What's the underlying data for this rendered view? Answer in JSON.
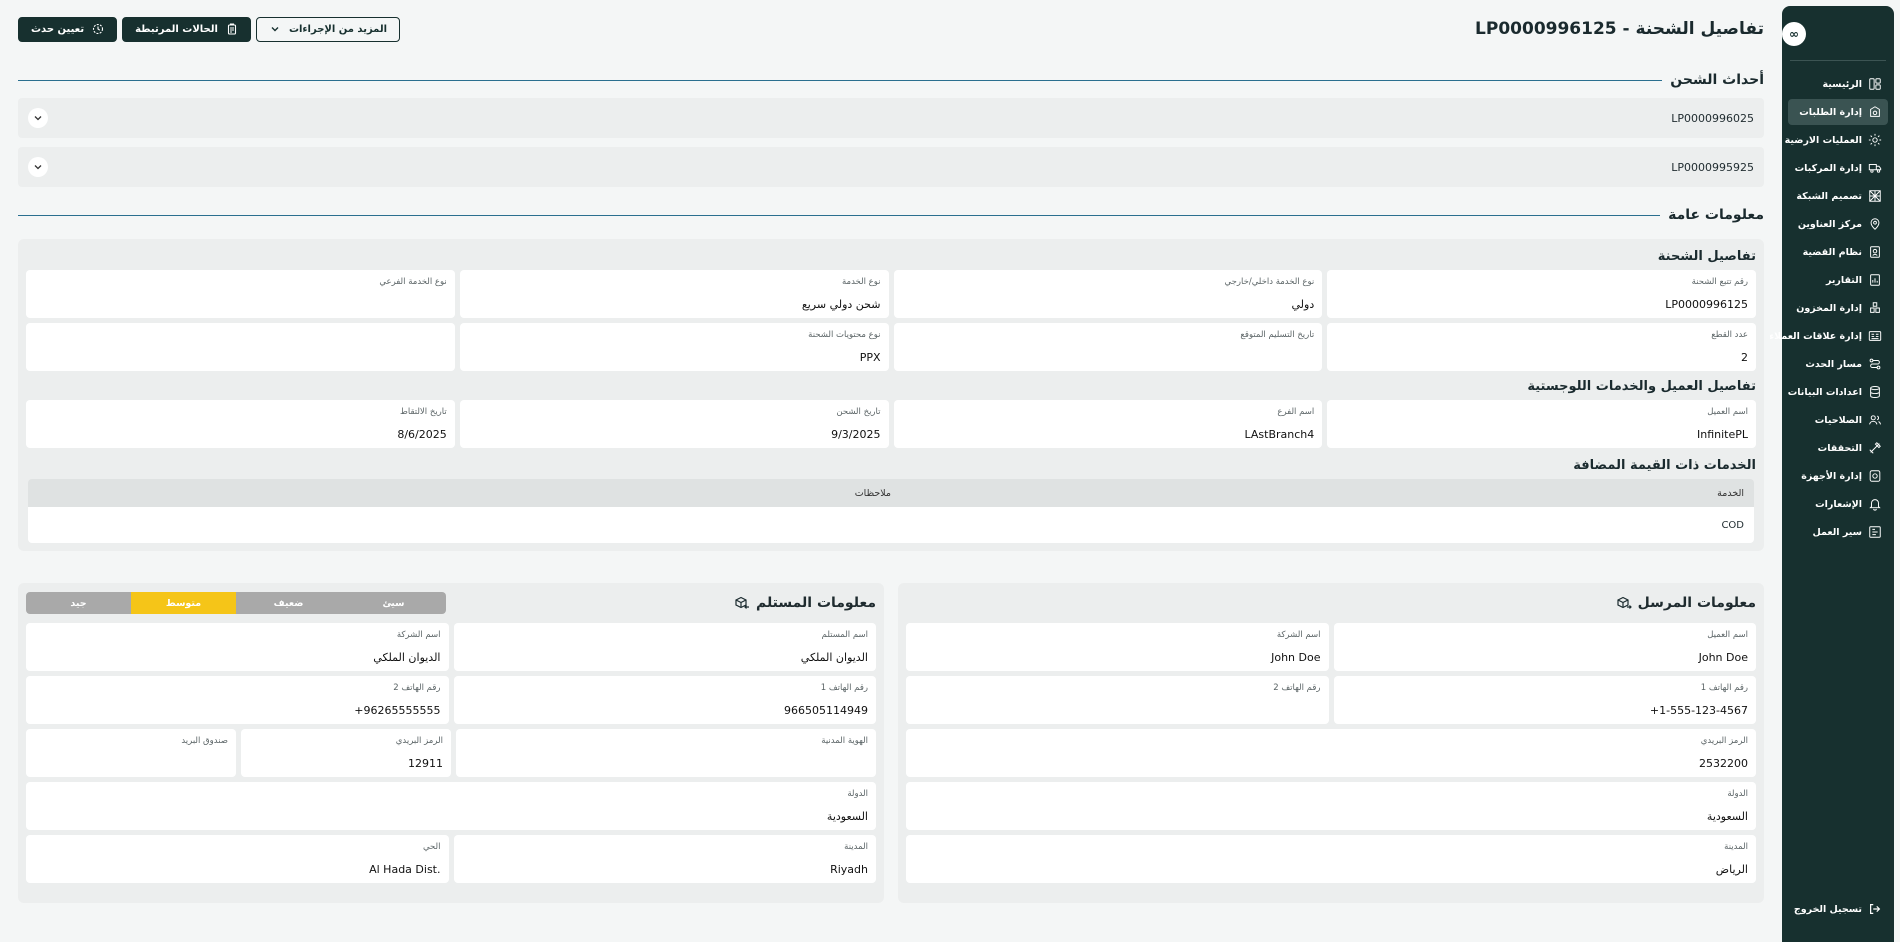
{
  "page": {
    "title": "تفاصيل الشحنة - LP0000996125"
  },
  "actions": {
    "assign_event": "تعيين حدث",
    "linked_cases": "الحالات المرتبطة",
    "more_actions": "المزيد من الإجراءات"
  },
  "sidebar": {
    "logo": "∞",
    "items": [
      {
        "label": "الرئيسية",
        "icon": "dashboard-icon"
      },
      {
        "label": "إدارة الطلبات",
        "icon": "orders-icon"
      },
      {
        "label": "العمليات الارضية",
        "icon": "ground-ops-icon"
      },
      {
        "label": "إدارة المركبات",
        "icon": "truck-icon"
      },
      {
        "label": "تصميم الشبكة",
        "icon": "network-icon"
      },
      {
        "label": "مركز العناوين",
        "icon": "location-icon"
      },
      {
        "label": "نظام القضية",
        "icon": "case-icon"
      },
      {
        "label": "التقارير",
        "icon": "report-icon"
      },
      {
        "label": "إدارة المخزون",
        "icon": "inventory-icon"
      },
      {
        "label": "إدارة علاقات العملاء",
        "icon": "crm-icon"
      },
      {
        "label": "مسار الحدث",
        "icon": "route-icon"
      },
      {
        "label": "اعدادات البيانات",
        "icon": "database-icon"
      },
      {
        "label": "الصلاحيات",
        "icon": "users-icon"
      },
      {
        "label": "التحققات",
        "icon": "tools-icon"
      },
      {
        "label": "إدارة الأجهزة",
        "icon": "devices-icon"
      },
      {
        "label": "الإشعارات",
        "icon": "bell-icon"
      },
      {
        "label": "سير العمل",
        "icon": "workflow-icon"
      }
    ],
    "active_index": 1,
    "logout": "تسجيل الخروج"
  },
  "events": {
    "title": "أحداث الشحن",
    "items": [
      "LP0000996025",
      "LP0000995925"
    ]
  },
  "general": {
    "title": "معلومات عامة",
    "shipment_details": {
      "title": "تفاصيل الشحنة",
      "row1": [
        {
          "label": "رقم تتبع الشحنة",
          "value": "LP0000996125"
        },
        {
          "label": "نوع الخدمة داخلي/خارجي",
          "value": "دولي"
        },
        {
          "label": "نوع الخدمة",
          "value": "شحن دولي سريع"
        },
        {
          "label": "نوع الخدمة الفرعي",
          "value": ""
        }
      ],
      "row2": [
        {
          "label": "عدد القطع",
          "value": "2"
        },
        {
          "label": "تاريخ التسليم المتوقع",
          "value": ""
        },
        {
          "label": "نوع محتويات الشحنة",
          "value": "PPX"
        },
        {
          "label": "",
          "value": ""
        }
      ]
    },
    "customer_details": {
      "title": "تفاصيل العميل والخدمات اللوجستية",
      "row1": [
        {
          "label": "اسم العميل",
          "value": "InfinitePL"
        },
        {
          "label": "اسم الفرع",
          "value": "LAstBranch4"
        },
        {
          "label": "تاريخ الشحن",
          "value": "9/3/2025"
        },
        {
          "label": "تاريخ الالتقاط",
          "value": "8/6/2025"
        }
      ]
    },
    "value_added": {
      "title": "الخدمات ذات القيمة المضافة",
      "col_service": "الخدمة",
      "col_notes": "ملاحظات",
      "rows": [
        {
          "service": "COD",
          "notes": ""
        }
      ]
    }
  },
  "sender": {
    "title": "معلومات المرسل",
    "customer_name_label": "اسم العميل",
    "customer_name": "John Doe",
    "company_label": "اسم الشركة",
    "company": "John Doe",
    "phone1_label": "رقم الهاتف 1",
    "phone1": "+1-555-123-4567",
    "phone2_label": "رقم الهاتف 2",
    "phone2": "",
    "postal_label": "الرمز البريدي",
    "postal": "2532200",
    "country_label": "الدولة",
    "country": "السعودية",
    "city_label": "المدينة",
    "city": "الرياض"
  },
  "receiver": {
    "title": "معلومات المستلم",
    "rating": {
      "labels": [
        "سيئ",
        "ضعيف",
        "متوسط",
        "جيد"
      ],
      "selected": "متوسط",
      "colors": [
        "#a9a9a9",
        "#a9a9a9",
        "#f5c518",
        "#a9a9a9"
      ]
    },
    "receiver_name_label": "اسم المستلم",
    "receiver_name": "الديوان الملكي",
    "company_label": "اسم الشركة",
    "company": "الديوان الملكي",
    "phone1_label": "رقم الهاتف 1",
    "phone1": "966505114949",
    "phone2_label": "رقم الهاتف 2",
    "phone2": "+96265555555",
    "national_id_label": "الهوية المدنية",
    "national_id": "",
    "postal_label": "الرمز البريدي",
    "postal": "12911",
    "pobox_label": "صندوق البريد",
    "pobox": "",
    "country_label": "الدولة",
    "country": "السعودية",
    "city_label": "المدينة",
    "city": "Riyadh",
    "district_label": "الحي",
    "district": "Al Hada Dist."
  },
  "colors": {
    "sidebar_bg": "#17302f",
    "accent_line": "#2a6f8f",
    "rating_selected": "#f5c518"
  }
}
